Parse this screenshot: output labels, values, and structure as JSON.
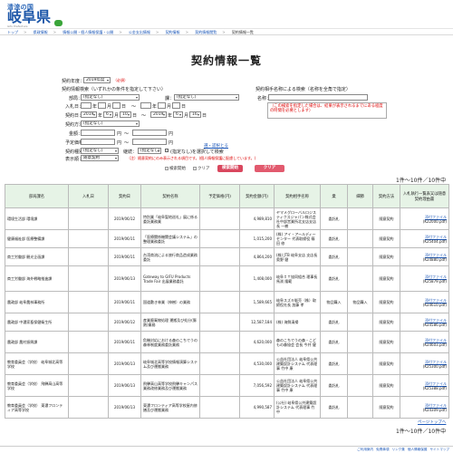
{
  "header": {
    "logo_tagline": "清流の国",
    "logo_main": "岐阜県",
    "logo_sub": "Gifu Prefecture"
  },
  "breadcrumb": [
    "トップ",
    "県政情報",
    "情報公開・個人情報保護・公開",
    "公金支出情報",
    "契約情報",
    "契約情報閲覧",
    "契約情報一覧"
  ],
  "page_title": "契約情報一覧",
  "form": {
    "year_label": "契約年度：",
    "year_value": "2019年度",
    "required_mark": "（必須）",
    "section_left_title": "契約情報検索（いずれかの条件を指定して下さい）",
    "section_right_title": "契約相手名称による検索（名称を全角で指定）",
    "dept_label": "部局：",
    "dept_value": "(指定なし)",
    "division_label": "課：",
    "division_value": "(指定なし)",
    "bidding_label": "入札日：",
    "contract_label": "契約日：",
    "date_from": {
      "year": "2019",
      "month": "6",
      "day": "10"
    },
    "date_to": {
      "year": "2019",
      "month": "6",
      "day": "16"
    },
    "date_unit_year": "年",
    "date_unit_month": "月",
    "date_unit_day": "日",
    "range_sep": "～",
    "kind_label": "契約種別：",
    "kind_value": "(指定なし)",
    "limit_label": "表示件数：",
    "limit_value": "(指定なし)",
    "contract_method_label": "契約方法：",
    "contract_method_value": "(指定なし)",
    "amount_label": "金額：",
    "amount_unit": "円",
    "amount_from_label": "予定価格：",
    "submitted_label": "(指定なし)",
    "continuous_label": "継続：",
    "continuous_value": "(指定なし)",
    "specified_check_label": "(指定なし)を選択して検索",
    "sort_label": "表示順：",
    "sort_value": "随意契約",
    "clear_link": "選・認択とる",
    "bottom_note": "（注）随意契約にのみ表示される項目です。(個人情報保護に配慮しています。)",
    "company_label": "名称：",
    "warn_text": "（この検索を指定した場合は、結果が表示されるまでにある程度の時間を必要とします）"
  },
  "buttons": {
    "search_open": "検索開始",
    "clear_icon": "クリア",
    "search_red": "検索開始",
    "clear_red": "クリア"
  },
  "results": {
    "counter_top": "1件～10件／10件中",
    "counter_bottom": "1件～10件／10件中",
    "next_page": "ページトップへ",
    "columns": [
      "部局課名",
      "入札日",
      "契約日",
      "契約名称",
      "予定価格(円)",
      "契約金額(円)",
      "契約相手名称",
      "業",
      "細節",
      "契約方法",
      "入札執行一覧表又は随意契約理由書"
    ],
    "rows": [
      {
        "dept": "環境生活部 環境課",
        "bid": "",
        "date": "2019/06/12",
        "name": "特別業「岐阜聖地巡礼」展に係る委託業務業",
        "planned": "",
        "amount": "4,989,810",
        "partner": "ヤマメグローバルロジスティクスジャパン株式会社中部営業所北支店支店長 一樹",
        "kind": "委託札",
        "detail": "",
        "method": "随意契約",
        "file": "添付ファイル",
        "size": "(K22000.pdf)"
      },
      {
        "dept": "健康福祉部 医療整備課",
        "bid": "",
        "date": "2019/06/11",
        "name": "「医療関係機関会議システム」の整理業務委託",
        "planned": "",
        "amount": "1,015,200",
        "partner": "(株) アイ・アールディーセンター 代表取締役 篠田 修",
        "kind": "委託札",
        "detail": "",
        "method": "随意契約",
        "file": "添付ファイル",
        "size": "(K25404.pdf)"
      },
      {
        "dept": "商工労働部 観光企画課",
        "bid": "",
        "date": "2019/06/11",
        "name": "台湾商流による旅行商品造成業務委託",
        "planned": "",
        "amount": "4,864,200",
        "partner": "(株) JTB 岐阜支店 支店長 奥野 健",
        "kind": "委託札",
        "detail": "",
        "method": "随意契約",
        "file": "添付ファイル",
        "size": "(K24880.pdf)"
      },
      {
        "dept": "商工労働部 海外戦略推進課",
        "bid": "",
        "date": "2019/06/13",
        "name": "Gateway to GIFU Products Trade Fair 出展業務委託",
        "planned": "",
        "amount": "1,408,000",
        "partner": "岐阜ＩＴ協同組合 理事長 馬渕 隆範",
        "kind": "委託札",
        "detail": "",
        "method": "随意契約",
        "file": "添付ファイル",
        "size": "(K25879.pdf)"
      },
      {
        "dept": "農政部 岐阜農林事務所",
        "bid": "",
        "date": "2019/06/11",
        "name": "国道敷き林業（伸樹）の業務",
        "planned": "",
        "amount": "1,589,665",
        "partner": "岐阜スズキ販売（株）取締役社長 加藤 孝",
        "kind": "物品購入",
        "detail": "物品購入",
        "method": "随意契約",
        "file": "添付ファイル",
        "size": "(K24610.pdf)"
      },
      {
        "dept": "農政部 中濃家畜保健衛生所",
        "bid": "",
        "date": "2019/06/12",
        "name": "産業廃棄物処理 運搬及び処分(豚熱)業務",
        "planned": "",
        "amount": "12,587,184",
        "partner": "(株) 海鮮清掃",
        "kind": "委託札",
        "detail": "",
        "method": "随意契約",
        "file": "添付ファイル",
        "size": "(K24586.pdf)"
      },
      {
        "dept": "農政部 農村振興課",
        "bid": "",
        "date": "2019/06/11",
        "name": "危機対応における森のこちでうの森林制度業務委託業務",
        "planned": "",
        "amount": "4,620,000",
        "partner": "森のこちでうの森・こどもの森協会 会長 今井 健",
        "kind": "委託札",
        "detail": "",
        "method": "随意契約",
        "file": "添付ファイル",
        "size": "(K24603.pdf)"
      },
      {
        "dept": "教育委員会（学校） 岐阜城北高等学校",
        "bid": "",
        "date": "2019/06/13",
        "name": "岐阜城北高等学校情報演算システム及び運搬業務",
        "planned": "",
        "amount": "4,530,000",
        "partner": "公益社団法人 岐阜県公共建築設計システム 代表理事 竹中 康",
        "kind": "委託札",
        "detail": "",
        "method": "随意契約",
        "file": "添付ファイル",
        "size": "(K25300.pdf)"
      },
      {
        "dept": "教育委員会（学校） 飛騨高山高等学校",
        "bid": "",
        "date": "2019/06/13",
        "name": "飛騨高山高等学校飛騨キャンパス業務改修業務及び運搬業務",
        "planned": "",
        "amount": "7,056,592",
        "partner": "公益社団法人 岐阜県公共建築設計システム 代表理事 竹中 康",
        "kind": "委託札",
        "detail": "",
        "method": "随意契約",
        "file": "添付ファイル",
        "size": "(K25388.pdf)"
      },
      {
        "dept": "教育委員会（学校） 東濃フロンティア高等学校",
        "bid": "",
        "date": "2019/06/13",
        "name": "東濃フロンティア高等学校屋内修繕及び運搬業務",
        "planned": "",
        "amount": "4,990,587",
        "partner": "(公社) 岐阜県公共建築設計システム 代表理事 竹中",
        "kind": "委託札",
        "detail": "",
        "method": "随意契約",
        "file": "添付ファイル",
        "size": "(K24309.pdf)"
      }
    ]
  },
  "footer": {
    "links": [
      "ご利用案内",
      "免責事項",
      "リンク集",
      "個人情報保護",
      "サイトマップ"
    ]
  },
  "colors": {
    "header_green": "#e6f3e6",
    "link_blue": "#1a56b8",
    "button_red": "#d9475e",
    "logo_blue": "#1c56a8"
  }
}
